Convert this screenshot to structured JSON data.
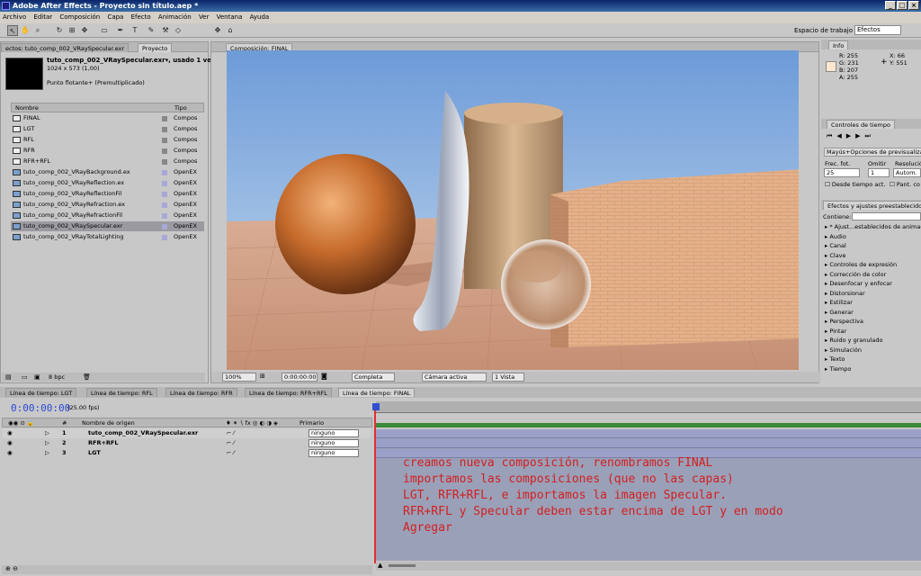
{
  "window": {
    "title": "Adobe After Effects - Proyecto sin título.aep *",
    "min": "_",
    "max": "□",
    "close": "×"
  },
  "menu": [
    "Archivo",
    "Editar",
    "Composición",
    "Capa",
    "Efecto",
    "Animación",
    "Ver",
    "Ventana",
    "Ayuda"
  ],
  "workspace": {
    "label": "Espacio de trabajo",
    "value": "Efectos"
  },
  "project": {
    "tabs": [
      "ectos: tuto_comp_002_VRaySpecular.exr",
      "Proyecto"
    ],
    "selected_name": "tuto_comp_002_VRaySpecular.exr▾, usado 1 vez",
    "selected_dims": "1024 x 573 (1,00)",
    "selected_depth": "Punto flotante+ (Premultiplicado)",
    "col_name": "Nombre",
    "col_type": "Tipo",
    "items": [
      {
        "name": "FINAL",
        "type": "Compos",
        "kind": "comp"
      },
      {
        "name": "LGT",
        "type": "Compos",
        "kind": "comp"
      },
      {
        "name": "RFL",
        "type": "Compos",
        "kind": "comp"
      },
      {
        "name": "RFR",
        "type": "Compos",
        "kind": "comp"
      },
      {
        "name": "RFR+RFL",
        "type": "Compos",
        "kind": "comp"
      },
      {
        "name": "tuto_comp_002_VRayBackground.ex",
        "type": "OpenEX",
        "kind": "img"
      },
      {
        "name": "tuto_comp_002_VRayReflection.ex",
        "type": "OpenEX",
        "kind": "img"
      },
      {
        "name": "tuto_comp_002_VRayReflectionFil",
        "type": "OpenEX",
        "kind": "img"
      },
      {
        "name": "tuto_comp_002_VRayRefraction.ex",
        "type": "OpenEX",
        "kind": "img"
      },
      {
        "name": "tuto_comp_002_VRayRefractionFil",
        "type": "OpenEX",
        "kind": "img"
      },
      {
        "name": "tuto_comp_002_VRaySpecular.exr",
        "type": "OpenEX",
        "kind": "img"
      },
      {
        "name": "tuto_comp_002_VRayTotalLighting",
        "type": "OpenEX",
        "kind": "img"
      }
    ],
    "bpc": "8 bpc"
  },
  "viewer": {
    "tab": "Composición: FINAL",
    "zoom": "100%",
    "time": "0:00:00:00",
    "resolution": "Completa",
    "camera": "Cámara activa",
    "views": "1 Vista"
  },
  "info": {
    "tab": "Info",
    "r": "R:  255",
    "g": "G:  231",
    "b": "B:  207",
    "a": "A:  255",
    "x": "X:  66",
    "y": "Y:  551",
    "swatch": "#ffe7cf"
  },
  "time_controls": {
    "tab": "Controles de tiempo",
    "preview_options": "Mayús+Opciones de previsualizació",
    "frec_label": "Frec. fot.",
    "frec_value": "25",
    "omit_label": "Omitir",
    "omit_value": "1",
    "res_label": "Resolució",
    "res_value": "Autom.",
    "from_current": "Desde tiempo act.",
    "fullscreen": "Pant. co"
  },
  "effects": {
    "tab": "Efectos y ajustes preestablecidos",
    "contains_label": "Contiene:",
    "items": [
      "* Ajust...establecidos de animación",
      "Audio",
      "Canal",
      "Clave",
      "Controles de expresión",
      "Corrección de color",
      "Desenfocar y enfocar",
      "Distorsionar",
      "Estilizar",
      "Generar",
      "Perspectiva",
      "Pintar",
      "Ruido y granulado",
      "Simulación",
      "Texto",
      "Tiempo"
    ]
  },
  "timeline_tabs": [
    "Línea de tiempo: LGT",
    "Línea de tiempo: RFL",
    "Línea de tiempo: RFR",
    "Línea de tiempo: RFR+RFL",
    "Línea de tiempo: FINAL"
  ],
  "timeline": {
    "timecode": "0:00:00:00",
    "fps": "(25.00 fps)",
    "col_source": "Nombre de origen",
    "col_parent": "Primario",
    "layers": [
      {
        "num": "1",
        "name": "tuto_comp_002_VRaySpecular.exr",
        "parent": "ninguno"
      },
      {
        "num": "2",
        "name": "RFR+RFL",
        "parent": "ninguno"
      },
      {
        "num": "3",
        "name": "LGT",
        "parent": "ninguno"
      }
    ]
  },
  "annotation": [
    "creamos nueva composición, renombramos FINAL",
    "importamos las composiciones (que no las capas)",
    "LGT, RFR+RFL, e importamos la imagen Specular.",
    "RFR+RFL y Specular deben estar encima de LGT y en modo",
    "Agregar"
  ]
}
